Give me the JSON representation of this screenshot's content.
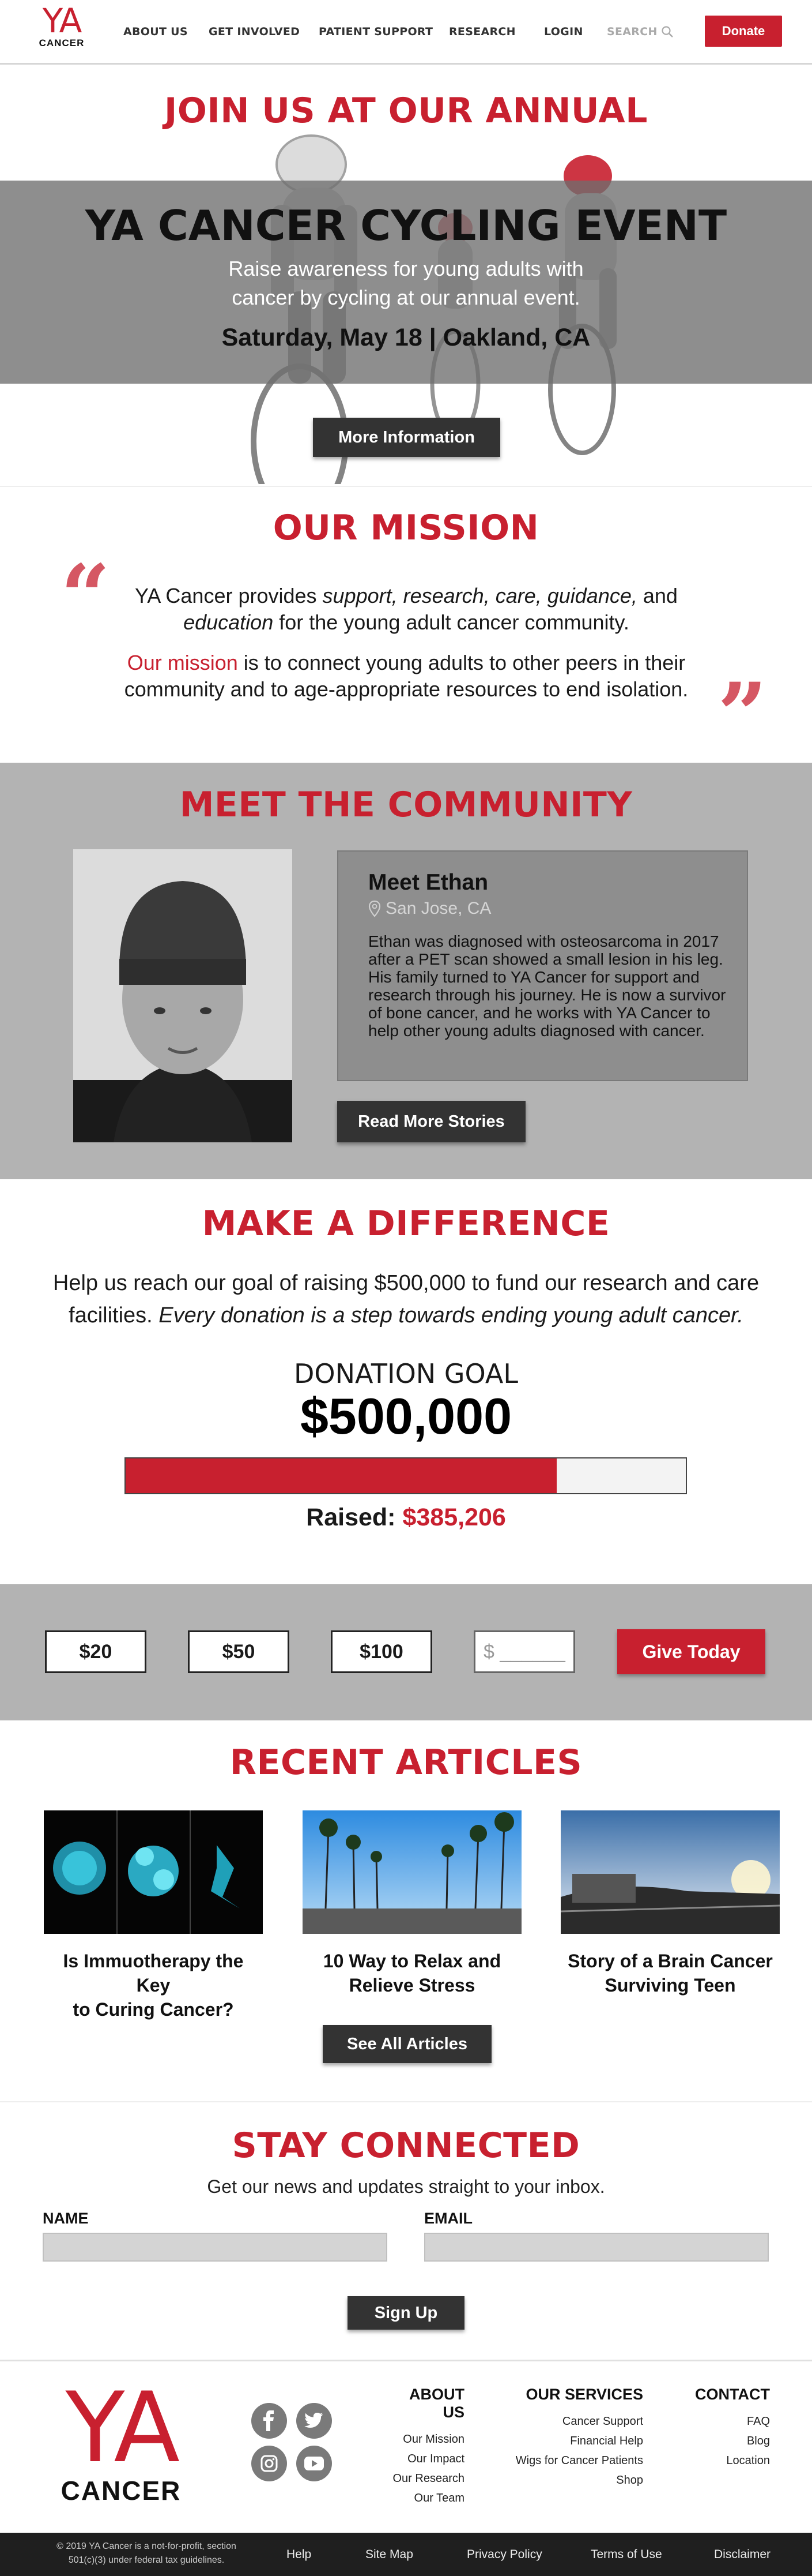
{
  "brand": {
    "logo_ya": "YA",
    "logo_cancer": "CANCER"
  },
  "nav": {
    "items": [
      "ABOUT US",
      "GET INVOLVED",
      "PATIENT SUPPORT",
      "RESEARCH",
      "LOGIN"
    ],
    "search_label": "SEARCH",
    "donate_label": "Donate"
  },
  "hero": {
    "kicker": "JOIN US AT OUR ANNUAL",
    "title": "YA CANCER CYCLING EVENT",
    "subtitle_line1": "Raise awareness for young adults with",
    "subtitle_line2": "cancer by cycling at our annual event.",
    "date": "Saturday, May 18 | Oakland, CA",
    "button": "More Information"
  },
  "mission": {
    "title": "OUR MISSION",
    "p1_start": "YA Cancer provides ",
    "p1_emph": "support, research, care, guidance,",
    "p1_and": " and",
    "p1_emph2": "education",
    "p1_end": " for the young adult cancer community.",
    "p2_strong": "Our mission",
    "p2_rest": " is to connect young adults to other peers in their community and to age-appropriate resources to end isolation.",
    "open_quote": "“",
    "close_quote": "”"
  },
  "community": {
    "title": "MEET THE COMMUNITY",
    "name": "Meet Ethan",
    "location": "San Jose, CA",
    "story": "Ethan was diagnosed with osteosarcoma in 2017 after a PET scan showed a small lesion in his leg. His family turned to YA Cancer for support and research through his journey. He is now a survivor of bone cancer, and he works with YA Cancer to help other young adults diagnosed with cancer.",
    "button": "Read More Stories"
  },
  "difference": {
    "title": "MAKE A DIFFERENCE",
    "text_plain": "Help us reach our goal of raising $500,000 to fund our research and care facilities. ",
    "text_italic": "Every donation is a step towards ending young adult cancer.",
    "goal_label": "DONATION GOAL",
    "goal_value": "$500,000",
    "raised_label": "Raised:",
    "raised_value": "$385,206",
    "progress_fraction": 0.77
  },
  "donation": {
    "amounts": [
      "$20",
      "$50",
      "$100"
    ],
    "custom_placeholder": "$ ______",
    "button": "Give Today"
  },
  "articles": {
    "title": "RECENT ARTICLES",
    "items": [
      {
        "title_l1": "Is Immuotherapy the Key",
        "title_l2": "to Curing Cancer?"
      },
      {
        "title_l1": "10 Way to Relax and",
        "title_l2": "Relieve Stress"
      },
      {
        "title_l1": "Story of a Brain Cancer",
        "title_l2": "Surviving Teen"
      }
    ],
    "button": "See All Articles"
  },
  "stay": {
    "title": "STAY CONNECTED",
    "subtitle": "Get our news and updates straight to your inbox.",
    "name_label": "NAME",
    "email_label": "EMAIL",
    "button": "Sign Up"
  },
  "footer": {
    "about": {
      "head": "ABOUT US",
      "links": [
        "Our Mission",
        "Our Impact",
        "Our Research",
        "Our Team"
      ]
    },
    "services": {
      "head": "OUR SERVICES",
      "links": [
        "Cancer Support",
        "Financial Help",
        "Wigs for Cancer Patients",
        "Shop"
      ]
    },
    "contact": {
      "head": "CONTACT",
      "links": [
        "FAQ",
        "Blog",
        "Location"
      ]
    },
    "copyright": "© 2019 YA Cancer is a not-for-profit, section 501(c)(3) under federal tax guidelines.",
    "bottom_links": [
      "Help",
      "Site Map",
      "Privacy Policy",
      "Terms of Use",
      "Disclaimer"
    ]
  },
  "colors": {
    "brand_red": "#c8202f",
    "dark_button": "#333333",
    "band_gray": "#b3b3b3"
  }
}
